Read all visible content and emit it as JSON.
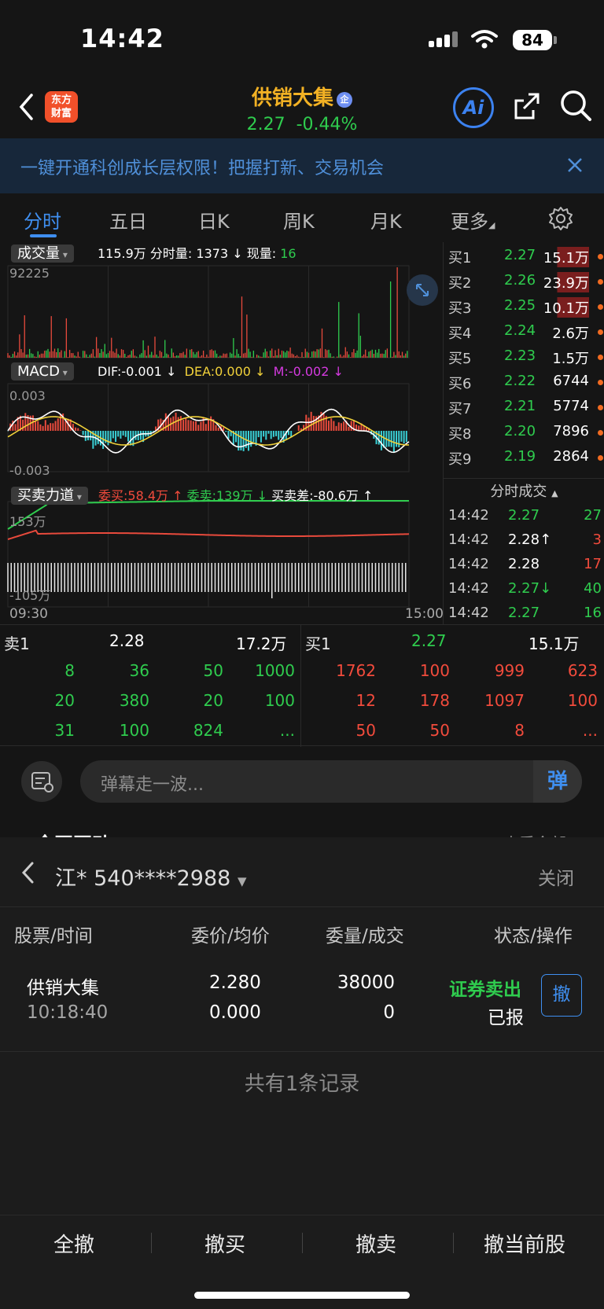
{
  "status": {
    "time": "14:42",
    "battery": "84"
  },
  "header": {
    "logo_line1": "东方",
    "logo_line2": "财富",
    "stock_name": "供销大集",
    "badge": "企",
    "price": "2.27",
    "change": "-0.44%",
    "ai_label": "Ai"
  },
  "banner": {
    "text": "一键开通科创成长层权限！把握打新、交易机会"
  },
  "tabs": [
    "分时",
    "五日",
    "日K",
    "周K",
    "月K",
    "更多"
  ],
  "volume": {
    "selector": "成交量",
    "total": "115.9万",
    "period_label": "分时量:",
    "period_value": "1373 ↓",
    "now_label": "现量:",
    "now_value": "16",
    "max_label": "92225"
  },
  "macd": {
    "selector": "MACD",
    "dif": "DIF:-0.001 ↓",
    "dea": "DEA:0.000 ↓",
    "m": "M:-0.002 ↓",
    "top": "0.003",
    "bottom": "-0.003"
  },
  "force": {
    "selector": "买卖力道",
    "buy": "委买:58.4万 ↑",
    "sell": "委卖:139万 ↓",
    "diff": "买卖差:-80.6万 ↑",
    "top": "153万",
    "bottom": "-105万",
    "start": "09:30",
    "end": "15:00"
  },
  "orderbook": [
    {
      "name": "买1",
      "price": "2.27",
      "vol": "15.1万"
    },
    {
      "name": "买2",
      "price": "2.26",
      "vol": "23.9万"
    },
    {
      "name": "买3",
      "price": "2.25",
      "vol": "10.1万"
    },
    {
      "name": "买4",
      "price": "2.24",
      "vol": "2.6万"
    },
    {
      "name": "买5",
      "price": "2.23",
      "vol": "1.5万"
    },
    {
      "name": "买6",
      "price": "2.22",
      "vol": "6744"
    },
    {
      "name": "买7",
      "price": "2.21",
      "vol": "5774"
    },
    {
      "name": "买8",
      "price": "2.20",
      "vol": "7896"
    },
    {
      "name": "买9",
      "price": "2.19",
      "vol": "2864"
    }
  ],
  "ticks_title": "分时成交",
  "ticks": [
    {
      "time": "14:42",
      "price": "2.27",
      "vol": "27",
      "pc": "#2fcc4e",
      "vc": "#2fcc4e"
    },
    {
      "time": "14:42",
      "price": "2.28↑",
      "vol": "3",
      "pc": "#ffffff",
      "vc": "#f24b3c"
    },
    {
      "time": "14:42",
      "price": "2.28",
      "vol": "17",
      "pc": "#ffffff",
      "vc": "#f24b3c"
    },
    {
      "time": "14:42",
      "price": "2.27↓",
      "vol": "40",
      "pc": "#2fcc4e",
      "vc": "#2fcc4e"
    },
    {
      "time": "14:42",
      "price": "2.27",
      "vol": "16",
      "pc": "#2fcc4e",
      "vc": "#2fcc4e"
    }
  ],
  "queue": {
    "sell_label": "卖1",
    "sell_price": "2.28",
    "sell_vol": "17.2万",
    "buy_label": "买1",
    "buy_price": "2.27",
    "buy_vol": "15.1万",
    "sell_rows": [
      [
        "8",
        "36",
        "50",
        "1000"
      ],
      [
        "20",
        "380",
        "20",
        "100"
      ],
      [
        "31",
        "100",
        "824",
        "..."
      ]
    ],
    "buy_rows": [
      [
        "1762",
        "100",
        "999",
        "623"
      ],
      [
        "12",
        "178",
        "1097",
        "100"
      ],
      [
        "50",
        "50",
        "8",
        "..."
      ]
    ]
  },
  "danmu": {
    "placeholder": "弹幕走一波...",
    "send_label": "弹"
  },
  "partial_section": {
    "left": "全网互动",
    "right": "查看全部 >"
  },
  "panel": {
    "account": "江*  540****2988",
    "close": "关闭",
    "headers": [
      "股票/时间",
      "委价/均价",
      "委量/成交",
      "状态/操作"
    ],
    "order": {
      "stock": "供销大集",
      "time": "10:18:40",
      "price": "2.280",
      "avg": "0.000",
      "qty": "38000",
      "filled": "0",
      "type": "证券卖出",
      "status": "已报",
      "cancel": "撤"
    },
    "summary": "共有1条记录"
  },
  "bottom": [
    "全撤",
    "撤买",
    "撤卖",
    "撤当前股"
  ]
}
